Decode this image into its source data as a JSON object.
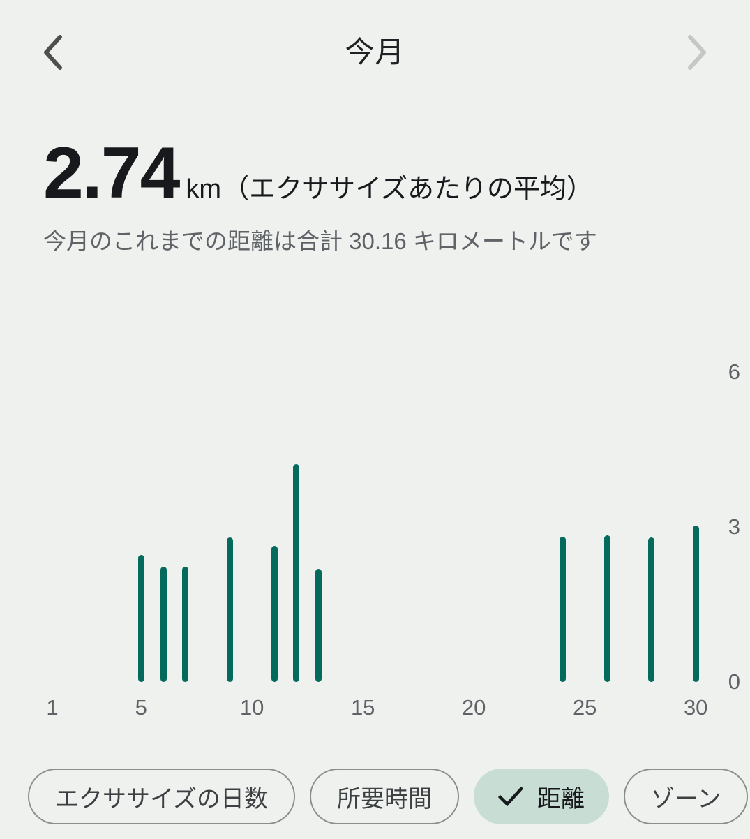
{
  "header": {
    "title": "今月",
    "prev_label": "‹",
    "next_label": "›"
  },
  "summary": {
    "value": "2.74",
    "unit": "km",
    "caption": "（エクササイズあたりの平均）",
    "subtitle": "今月のこれまでの距離は合計 30.16 キロメートルです"
  },
  "chips": [
    {
      "label": "エクササイズの日数",
      "selected": false
    },
    {
      "label": "所要時間",
      "selected": false
    },
    {
      "label": "距離",
      "selected": true
    },
    {
      "label": "ゾーン",
      "selected": false
    }
  ],
  "colors": {
    "background": "#eff1ee",
    "bar": "#046a5b",
    "chip_selected_bg": "#c8ddd4",
    "chip_border": "#8a8f8b",
    "muted_text": "#5f6368"
  },
  "chart_data": {
    "type": "bar",
    "title": "",
    "xlabel": "",
    "ylabel": "",
    "unit": "km",
    "grid": false,
    "legend": "none",
    "xlim": [
      1,
      31
    ],
    "ylim": [
      0,
      6
    ],
    "yticks": [
      "0",
      "3",
      "6"
    ],
    "ytick_values": [
      0,
      3,
      6
    ],
    "xticks": [
      "1",
      "5",
      "10",
      "15",
      "20",
      "25",
      "30"
    ],
    "xtick_values": [
      1,
      5,
      10,
      15,
      20,
      25,
      30
    ],
    "x": [
      5,
      6,
      7,
      9,
      11,
      12,
      13,
      24,
      26,
      28,
      30
    ],
    "values": [
      2.46,
      2.23,
      2.23,
      2.8,
      2.64,
      4.22,
      2.19,
      2.81,
      2.84,
      2.8,
      3.03
    ],
    "total": 30.16,
    "average": 2.74
  }
}
